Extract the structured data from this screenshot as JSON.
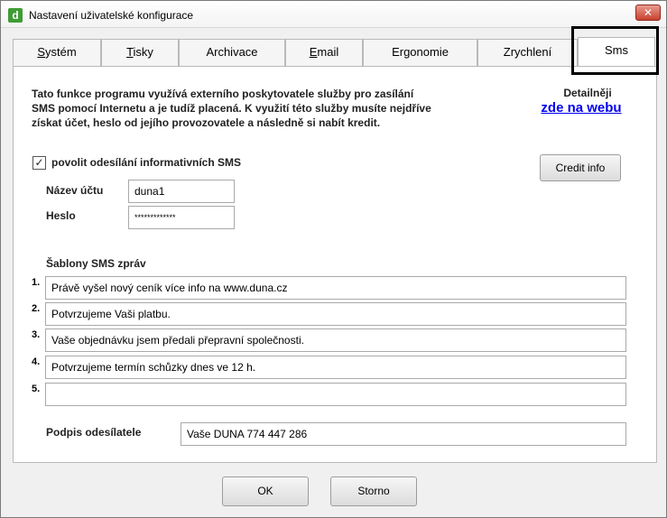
{
  "window": {
    "title": "Nastavení uživatelské konfigurace",
    "close_glyph": "✕",
    "app_icon_letter": "d"
  },
  "tabs": [
    {
      "label": "Systém",
      "underline": "S",
      "rest": "ystém"
    },
    {
      "label": "Tisky",
      "underline": "T",
      "rest": "isky"
    },
    {
      "label": "Archivace",
      "underline": "",
      "rest": "Archivace"
    },
    {
      "label": "Email",
      "underline": "E",
      "rest": "mail"
    },
    {
      "label": "Ergonomie",
      "underline": "",
      "rest": "Ergonomie"
    },
    {
      "label": "Zrychlení",
      "underline": "",
      "rest": "Zrychlení"
    },
    {
      "label": "Sms",
      "underline": "",
      "rest": "Sms",
      "active": true
    }
  ],
  "sms": {
    "info_lines": [
      "Tato funkce programu využívá externího poskytovatele služby pro zasílání",
      "SMS pomocí Internetu a je tudíž placená. K využití této služby musíte nejdříve",
      "získat účet, heslo od jejího provozovatele a následně si nabít kredit."
    ],
    "detail_label": "Detailněji",
    "detail_link": "zde na webu",
    "enable_label": "povolit odesílání informativních SMS",
    "enable_checked": true,
    "check_glyph": "✓",
    "credit_button": "Credit info",
    "account_label": "Název účtu",
    "account_value": "duna1",
    "password_label": "Heslo",
    "password_value": "*************",
    "templates_title": "Šablony SMS zpráv",
    "templates": [
      {
        "num": "1.",
        "text": "Právě vyšel nový ceník více info na www.duna.cz"
      },
      {
        "num": "2.",
        "text": "Potvrzujeme Vaši platbu."
      },
      {
        "num": "3.",
        "text": "Vaše objednávku jsem předali přepravní společnosti."
      },
      {
        "num": "4.",
        "text": "Potvrzujeme termín schůzky dnes ve 12 h."
      },
      {
        "num": "5.",
        "text": ""
      }
    ],
    "signature_label": "Podpis odesílatele",
    "signature_value": "Vaše DUNA 774 447 286"
  },
  "footer": {
    "ok_label": "OK",
    "cancel_label": "Storno"
  }
}
